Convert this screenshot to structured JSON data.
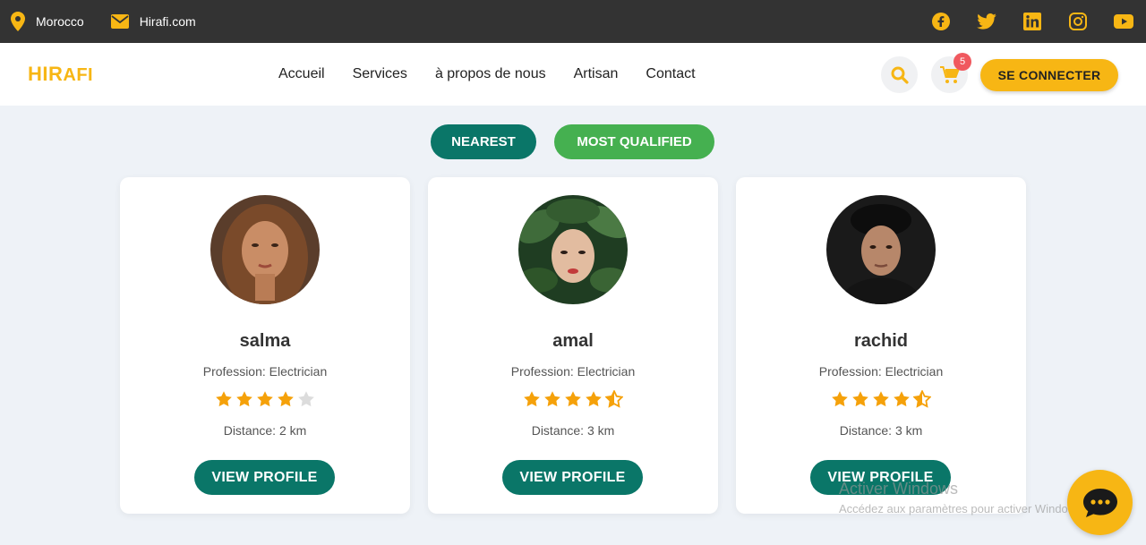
{
  "topbar": {
    "location": "Morocco",
    "email": "Hirafi.com",
    "social_icons": [
      "facebook-icon",
      "twitter-icon",
      "linkedin-icon",
      "instagram-icon",
      "youtube-icon"
    ],
    "icon_color": "#f7b614"
  },
  "nav": {
    "logo_part1": "HIR",
    "logo_part2": "AFI",
    "menu": [
      "Accueil",
      "Services",
      "à propos de nous",
      "Artisan",
      "Contact"
    ],
    "cart_count": "5",
    "login_label": "SE CONNECTER"
  },
  "filters": {
    "nearest": "NEAREST",
    "qualified": "MOST QUALIFIED"
  },
  "artisans": [
    {
      "name": "salma",
      "profession": "Profession: Electrician",
      "rating": 4,
      "distance": "Distance: 2 km",
      "button": "VIEW PROFILE"
    },
    {
      "name": "amal",
      "profession": "Profession: Electrician",
      "rating": 4.5,
      "distance": "Distance: 3 km",
      "button": "VIEW PROFILE"
    },
    {
      "name": "rachid",
      "profession": "Profession: Electrician",
      "rating": 4.5,
      "distance": "Distance: 3 km",
      "button": "VIEW PROFILE"
    }
  ],
  "watermark": {
    "line1": "Activer Windows",
    "line2": "Accédez aux paramètres pour activer Windows."
  },
  "colors": {
    "accent": "#f7b614",
    "primary": "#0a7668",
    "secondary": "#45b050",
    "star": "#f5a10a"
  }
}
